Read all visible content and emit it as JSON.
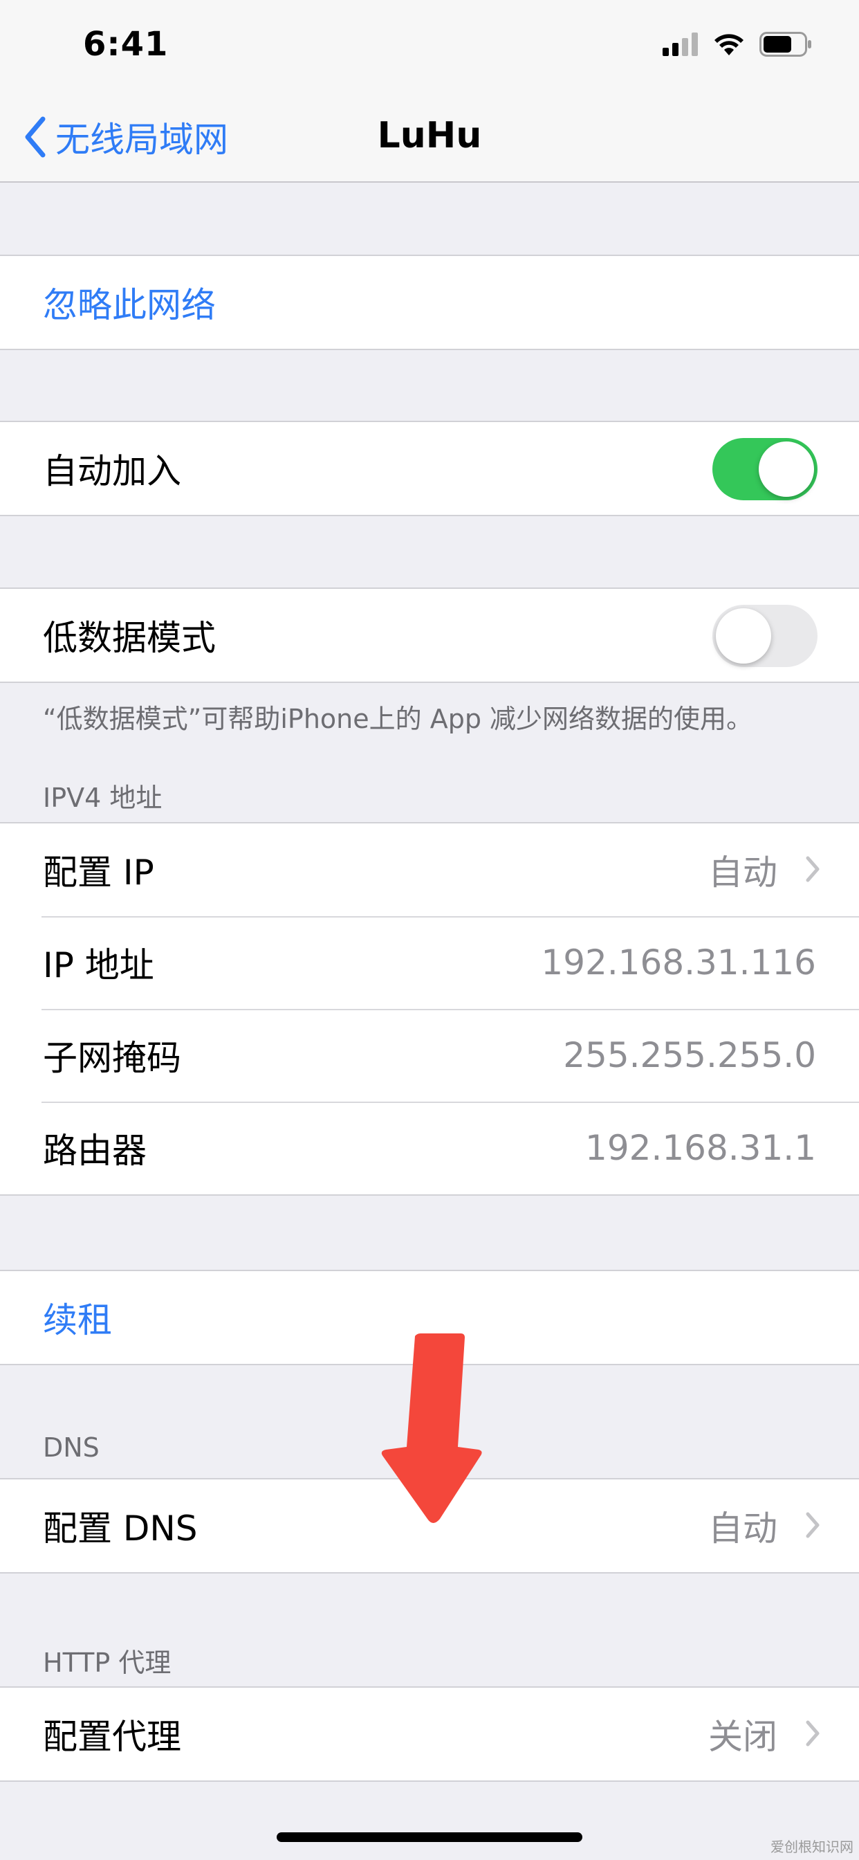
{
  "status_bar": {
    "time": "6:41",
    "icons": [
      "cellular-signal-icon",
      "wifi-icon",
      "battery-icon"
    ]
  },
  "nav": {
    "back_label": "无线局域网",
    "title": "LuHu"
  },
  "groups": {
    "forget": {
      "label": "忽略此网络"
    },
    "auto_join": {
      "label": "自动加入",
      "enabled": true
    },
    "low_data": {
      "label": "低数据模式",
      "enabled": false
    },
    "low_data_note": "“低数据模式”可帮助iPhone上的 App 减少网络数据的使用。",
    "ipv4_header": "IPV4 地址",
    "ipv4_rows": [
      {
        "label": "配置 IP",
        "value": "自动"
      },
      {
        "label": "IP 地址",
        "value": "192.168.31.116"
      },
      {
        "label": "子网掩码",
        "value": "255.255.255.0"
      },
      {
        "label": "路由器",
        "value": "192.168.31.1"
      }
    ],
    "renew": {
      "label": "续租"
    },
    "dns_header": "DNS",
    "dns_row": {
      "label": "配置 DNS",
      "value": "自动"
    },
    "proxy_header": "HTTP 代理",
    "proxy_row": {
      "label": "配置代理",
      "value": "关闭"
    }
  },
  "watermark": "爱创根知识网",
  "colors": {
    "accent": "#2f7cf6",
    "toggle_on": "#34c759",
    "annotation_arrow": "#f4473b"
  }
}
